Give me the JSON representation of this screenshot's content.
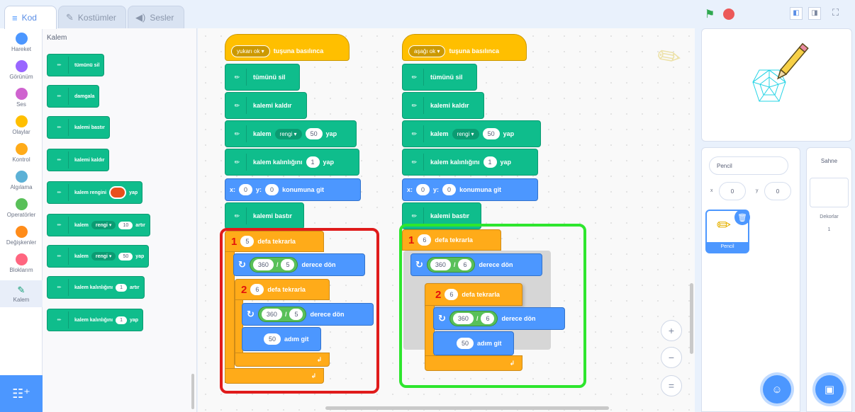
{
  "tabs": [
    {
      "label": "Kod",
      "icon": "code-icon"
    },
    {
      "label": "Kostümler",
      "icon": "brush-icon"
    },
    {
      "label": "Sesler",
      "icon": "speaker-icon"
    }
  ],
  "categories": [
    {
      "label": "Hareket",
      "color": "#4c97ff"
    },
    {
      "label": "Görünüm",
      "color": "#9966ff"
    },
    {
      "label": "Ses",
      "color": "#cf63cf"
    },
    {
      "label": "Olaylar",
      "color": "#ffbf00"
    },
    {
      "label": "Kontrol",
      "color": "#ffab19"
    },
    {
      "label": "Algılama",
      "color": "#5cb1d6"
    },
    {
      "label": "Operatörler",
      "color": "#59c059"
    },
    {
      "label": "Değişkenler",
      "color": "#ff8c1a"
    },
    {
      "label": "Bloklarım",
      "color": "#ff6680"
    },
    {
      "label": "Kalem",
      "color": "#0fbd8c"
    }
  ],
  "palette": {
    "title": "Kalem",
    "blocks": {
      "clear": "tümünü sil",
      "stamp": "damgala",
      "pen_down": "kalemi bastır",
      "pen_up": "kalemi kaldır",
      "set_color_a": "kalem rengini",
      "set_color_b": "yap",
      "change_param_a": "kalem",
      "change_param_dd": "rengi ▾",
      "change_param_val": "10",
      "change_param_b": "artır",
      "set_param_a": "kalem",
      "set_param_dd": "rengi ▾",
      "set_param_val": "50",
      "set_param_b": "yap",
      "change_size_a": "kalem kalınlığını",
      "change_size_val": "1",
      "change_size_b": "artır",
      "set_size_a": "kalem kalınlığını",
      "set_size_val": "1",
      "set_size_b": "yap"
    }
  },
  "script_left": {
    "hat_key": "yukarı ok ▾",
    "hat_text": "tuşuna basılınca",
    "clear": "tümünü sil",
    "pen_up": "kalemi kaldır",
    "set_param_a": "kalem",
    "set_param_dd": "rengi ▾",
    "set_param_val": "50",
    "set_param_b": "yap",
    "set_size_a": "kalem kalınlığını",
    "set_size_val": "1",
    "set_size_b": "yap",
    "goto_x_label": "x:",
    "goto_x": "0",
    "goto_y_label": "y:",
    "goto_y": "0",
    "goto_text": "konumuna git",
    "pen_down": "kalemi bastır",
    "outer_num": "1",
    "outer_times": "5",
    "outer_text": "defa tekrarla",
    "turn1_a": "360",
    "turn1_div": "/",
    "turn1_b": "5",
    "turn1_text": "derece dön",
    "inner_num": "2",
    "inner_times": "6",
    "inner_text": "defa tekrarla",
    "turn2_a": "360",
    "turn2_div": "/",
    "turn2_b": "5",
    "turn2_text": "derece dön",
    "move_steps": "50",
    "move_text": "adım git"
  },
  "script_right": {
    "hat_key": "aşağı ok ▾",
    "hat_text": "tuşuna basılınca",
    "clear": "tümünü sil",
    "pen_up": "kalemi kaldır",
    "set_param_a": "kalem",
    "set_param_dd": "rengi ▾",
    "set_param_val": "50",
    "set_param_b": "yap",
    "set_size_a": "kalem kalınlığını",
    "set_size_val": "1",
    "set_size_b": "yap",
    "goto_x_label": "x:",
    "goto_x": "0",
    "goto_y_label": "y:",
    "goto_y": "0",
    "goto_text": "konumuna git",
    "pen_down": "kalemi bastır",
    "outer_num": "1",
    "outer_times": "6",
    "outer_text": "defa tekrarla",
    "turn1_a": "360",
    "turn1_div": "/",
    "turn1_b": "6",
    "turn1_text": "derece dön",
    "inner_num": "2",
    "inner_times": "6",
    "inner_text": "defa tekrarla",
    "turn2_a": "360",
    "turn2_div": "/",
    "turn2_b": "6",
    "turn2_text": "derece dön",
    "move_steps": "50",
    "move_text": "adım git"
  },
  "zoom": {
    "in": "+",
    "out": "−",
    "reset": "="
  },
  "sprite_info": {
    "name": "Pencil",
    "x_label": "x",
    "x": "0",
    "y_label": "y",
    "y": "0",
    "tile_name": "Pencil"
  },
  "stage_pane": {
    "title": "Sahne",
    "backdrops_label": "Dekorlar",
    "backdrops_count": "1"
  },
  "colors": {
    "pen_color_swatch": "#e84f1c",
    "highlight_red": "#e01b1b",
    "highlight_green": "#2ee62e"
  }
}
